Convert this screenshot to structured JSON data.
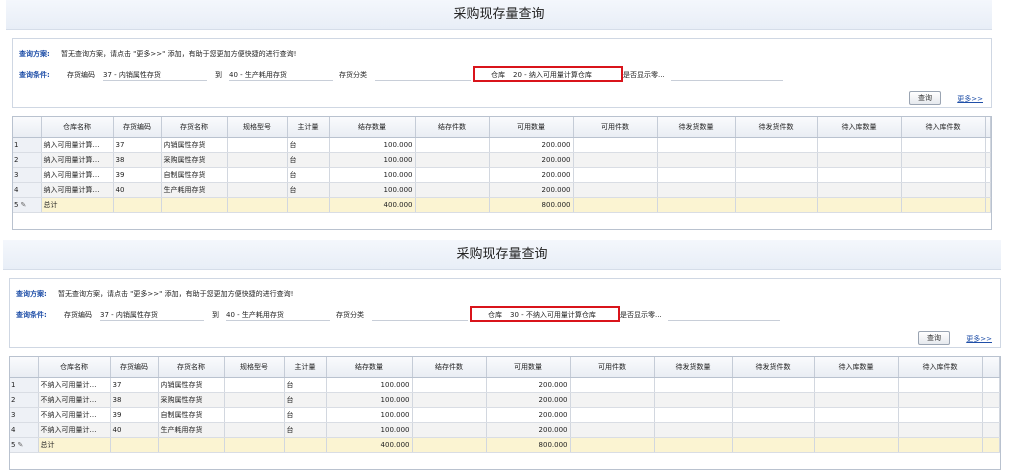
{
  "panels": [
    {
      "title": "采购现存量查询",
      "scheme_label": "查询方案:",
      "scheme_text": "暂无查询方案，请点击 \"更多>>\" 添加，有助于您更加方便快捷的进行查询!",
      "cond_label": "查询条件:",
      "item_code_label": "存货编码",
      "item_code_from": "37 - 内销属性存货",
      "to_label": "到",
      "item_code_to": "40 - 生产耗用存货",
      "category_label": "存货分类",
      "warehouse_label": "仓库",
      "warehouse_value": "20 - 纳入可用量计算仓库",
      "show_zero_label": "是否显示零...",
      "query_button": "查询",
      "more_link": "更多>>",
      "columns": [
        "仓库名称",
        "存货编码",
        "存货名称",
        "规格型号",
        "主计量",
        "结存数量",
        "结存件数",
        "可用数量",
        "可用件数",
        "待发货数量",
        "待发货件数",
        "待入库数量",
        "待入库件数"
      ],
      "rows": [
        {
          "no": "1",
          "wh": "纳入可用量计算…",
          "code": "37",
          "name": "内销属性存货",
          "spec": "",
          "unit": "台",
          "qty": "100.000",
          "pcs": "",
          "avail": "200.000"
        },
        {
          "no": "2",
          "wh": "纳入可用量计算…",
          "code": "38",
          "name": "采购属性存货",
          "spec": "",
          "unit": "台",
          "qty": "100.000",
          "pcs": "",
          "avail": "200.000"
        },
        {
          "no": "3",
          "wh": "纳入可用量计算…",
          "code": "39",
          "name": "自制属性存货",
          "spec": "",
          "unit": "台",
          "qty": "100.000",
          "pcs": "",
          "avail": "200.000"
        },
        {
          "no": "4",
          "wh": "纳入可用量计算…",
          "code": "40",
          "name": "生产耗用存货",
          "spec": "",
          "unit": "台",
          "qty": "100.000",
          "pcs": "",
          "avail": "200.000"
        }
      ],
      "total": {
        "no": "5",
        "label": "总计",
        "qty": "400.000",
        "avail": "800.000"
      }
    },
    {
      "title": "采购现存量查询",
      "scheme_label": "查询方案:",
      "scheme_text": "暂无查询方案，请点击 \"更多>>\" 添加，有助于您更加方便快捷的进行查询!",
      "cond_label": "查询条件:",
      "item_code_label": "存货编码",
      "item_code_from": "37 - 内销属性存货",
      "to_label": "到",
      "item_code_to": "40 - 生产耗用存货",
      "category_label": "存货分类",
      "warehouse_label": "仓库",
      "warehouse_value": "30 - 不纳入可用量计算仓库",
      "show_zero_label": "是否显示零...",
      "query_button": "查询",
      "more_link": "更多>>",
      "columns": [
        "仓库名称",
        "存货编码",
        "存货名称",
        "规格型号",
        "主计量",
        "结存数量",
        "结存件数",
        "可用数量",
        "可用件数",
        "待发货数量",
        "待发货件数",
        "待入库数量",
        "待入库件数"
      ],
      "rows": [
        {
          "no": "1",
          "wh": "不纳入可用量计…",
          "code": "37",
          "name": "内销属性存货",
          "spec": "",
          "unit": "台",
          "qty": "100.000",
          "pcs": "",
          "avail": "200.000"
        },
        {
          "no": "2",
          "wh": "不纳入可用量计…",
          "code": "38",
          "name": "采购属性存货",
          "spec": "",
          "unit": "台",
          "qty": "100.000",
          "pcs": "",
          "avail": "200.000"
        },
        {
          "no": "3",
          "wh": "不纳入可用量计…",
          "code": "39",
          "name": "自制属性存货",
          "spec": "",
          "unit": "台",
          "qty": "100.000",
          "pcs": "",
          "avail": "200.000"
        },
        {
          "no": "4",
          "wh": "不纳入可用量计…",
          "code": "40",
          "name": "生产耗用存货",
          "spec": "",
          "unit": "台",
          "qty": "100.000",
          "pcs": "",
          "avail": "200.000"
        }
      ],
      "total": {
        "no": "5",
        "label": "总计",
        "qty": "400.000",
        "avail": "800.000"
      }
    }
  ],
  "colors": {
    "highlight": "#d9141b",
    "label_blue": "#1f4fa8",
    "total_row": "#fbf4d2"
  }
}
